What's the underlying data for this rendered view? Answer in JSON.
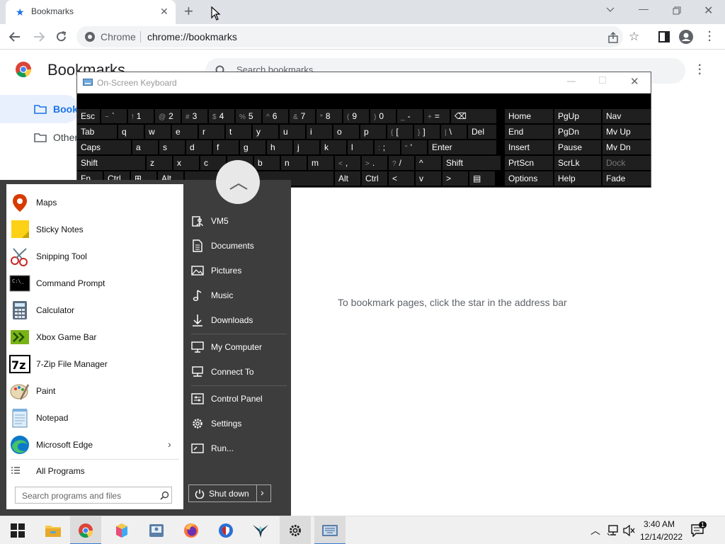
{
  "browser": {
    "tab_title": "Bookmarks",
    "omnibox_site": "Chrome",
    "omnibox_url": "chrome://bookmarks"
  },
  "bookmarks_page": {
    "title": "Bookmarks",
    "search_placeholder": "Search bookmarks",
    "folders": [
      "Bookmarks bar",
      "Other bookmarks"
    ],
    "folder_visible": [
      "Book",
      "Other"
    ],
    "empty_message": "To bookmark pages, click the star in the address bar"
  },
  "osk": {
    "title": "On-Screen Keyboard",
    "rows": [
      [
        [
          "Esc",
          ""
        ],
        [
          "`",
          "~"
        ],
        [
          "1",
          "!"
        ],
        [
          "2",
          "@"
        ],
        [
          "3",
          "#"
        ],
        [
          "4",
          "$"
        ],
        [
          "5",
          "%"
        ],
        [
          "6",
          "^"
        ],
        [
          "7",
          "&"
        ],
        [
          "8",
          "*"
        ],
        [
          "9",
          "("
        ],
        [
          "0",
          ")"
        ],
        [
          "-",
          "_"
        ],
        [
          "=",
          "+"
        ],
        [
          "⌫",
          ""
        ]
      ],
      [
        [
          "Tab",
          ""
        ],
        [
          "q",
          ""
        ],
        [
          "w",
          ""
        ],
        [
          "e",
          ""
        ],
        [
          "r",
          ""
        ],
        [
          "t",
          ""
        ],
        [
          "y",
          ""
        ],
        [
          "u",
          ""
        ],
        [
          "i",
          ""
        ],
        [
          "o",
          ""
        ],
        [
          "p",
          ""
        ],
        [
          "[",
          "{"
        ],
        [
          "]",
          "}"
        ],
        [
          "\\",
          "|"
        ],
        [
          "Del",
          ""
        ]
      ],
      [
        [
          "Caps",
          ""
        ],
        [
          "a",
          ""
        ],
        [
          "s",
          ""
        ],
        [
          "d",
          ""
        ],
        [
          "f",
          ""
        ],
        [
          "g",
          ""
        ],
        [
          "h",
          ""
        ],
        [
          "j",
          ""
        ],
        [
          "k",
          ""
        ],
        [
          "l",
          ""
        ],
        [
          ";",
          ":"
        ],
        [
          "'",
          "\""
        ],
        [
          "Enter",
          ""
        ]
      ],
      [
        [
          "Shift",
          ""
        ],
        [
          "z",
          ""
        ],
        [
          "x",
          ""
        ],
        [
          "c",
          ""
        ],
        [
          "v",
          ""
        ],
        [
          "b",
          ""
        ],
        [
          "n",
          ""
        ],
        [
          "m",
          ""
        ],
        [
          ",",
          "<"
        ],
        [
          ".",
          ">"
        ],
        [
          "/",
          "?"
        ],
        [
          "^",
          ""
        ],
        [
          "Shift",
          ""
        ]
      ],
      [
        [
          "Fn",
          ""
        ],
        [
          "Ctrl",
          ""
        ],
        [
          "⊞",
          ""
        ],
        [
          "Alt",
          ""
        ],
        [
          "",
          ""
        ],
        [
          "Alt",
          ""
        ],
        [
          "Ctrl",
          ""
        ],
        [
          "<",
          ""
        ],
        [
          "v",
          ""
        ],
        [
          ">",
          ""
        ],
        [
          "▤",
          ""
        ]
      ]
    ],
    "nav": [
      [
        "Home",
        "PgUp",
        "Nav"
      ],
      [
        "End",
        "PgDn",
        "Mv Up"
      ],
      [
        "Insert",
        "Pause",
        "Mv Dn"
      ],
      [
        "PrtScn",
        "ScrLk",
        "Dock"
      ],
      [
        "Options",
        "Help",
        "Fade"
      ]
    ]
  },
  "start_menu": {
    "apps": [
      "Maps",
      "Sticky Notes",
      "Snipping Tool",
      "Command Prompt",
      "Calculator",
      "Xbox Game Bar",
      "7-Zip File Manager",
      "Paint",
      "Notepad",
      "Microsoft Edge"
    ],
    "all_programs": "All Programs",
    "search_placeholder": "Search programs and files",
    "places": [
      "VM5",
      "Documents",
      "Pictures",
      "Music",
      "Downloads",
      "My Computer",
      "Connect To",
      "Control Panel",
      "Settings",
      "Run..."
    ],
    "shutdown_label": "Shut down"
  },
  "taskbar": {
    "time": "3:40 AM",
    "date": "12/14/2022",
    "notification_count": "1"
  },
  "colors": {
    "accent_blue": "#1a73e8",
    "start_dark": "#3d3d3d",
    "osk_key": "#1f1f1f"
  }
}
